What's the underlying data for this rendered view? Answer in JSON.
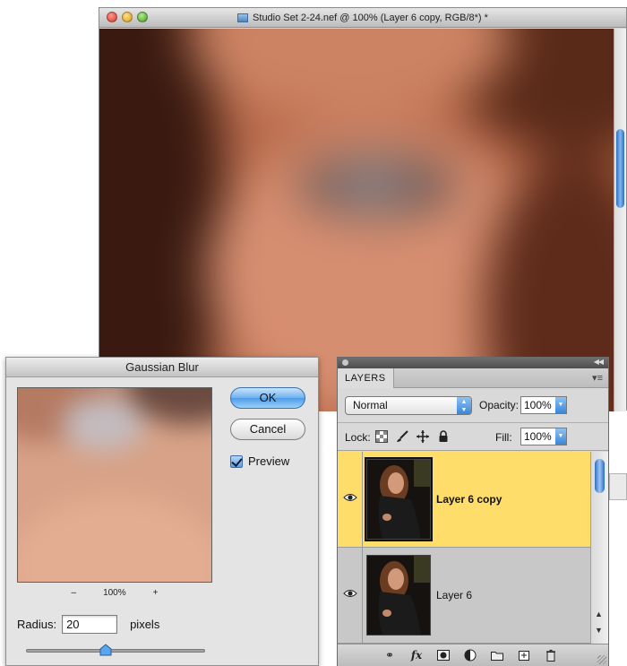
{
  "document_window": {
    "title": "Studio Set 2-24.nef @ 100% (Layer 6 copy, RGB/8*) *"
  },
  "gaussian_blur": {
    "title": "Gaussian Blur",
    "ok_label": "OK",
    "cancel_label": "Cancel",
    "preview_label": "Preview",
    "preview_checked": true,
    "zoom_minus": "–",
    "zoom_level": "100%",
    "zoom_plus": "+",
    "radius_label": "Radius:",
    "radius_value": "20",
    "radius_unit": "pixels"
  },
  "layers_panel": {
    "tab_label": "LAYERS",
    "blend_mode": "Normal",
    "opacity_label": "Opacity:",
    "opacity_value": "100%",
    "lock_label": "Lock:",
    "fill_label": "Fill:",
    "fill_value": "100%",
    "layers": [
      {
        "name": "Layer 6 copy",
        "selected": true,
        "visible": true
      },
      {
        "name": "Layer 6",
        "selected": false,
        "visible": true
      }
    ],
    "footer_icons": [
      "link-layers-icon",
      "fx-icon",
      "add-mask-icon",
      "adjustment-layer-icon",
      "new-group-icon",
      "new-layer-icon",
      "trash-icon"
    ]
  },
  "colors": {
    "selected_layer": "#fedd6a",
    "ok_button": "#4d9be6"
  }
}
